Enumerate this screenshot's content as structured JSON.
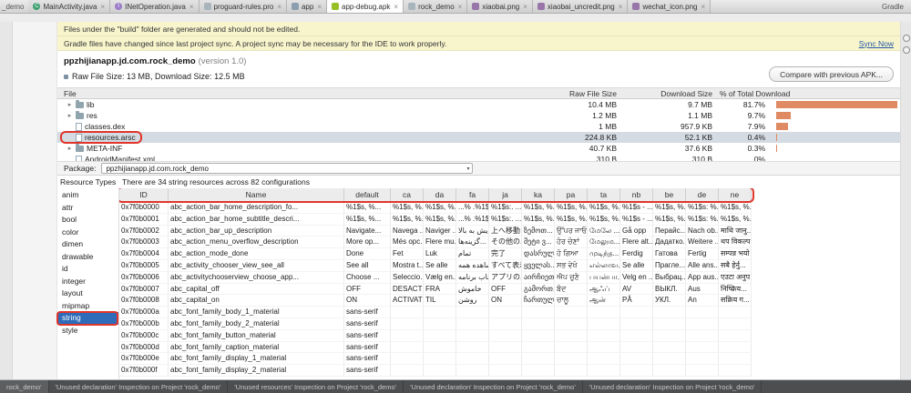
{
  "window": {
    "left_strip_label": "_demo",
    "gradle_label": "Gradle"
  },
  "icons": {
    "close": "×",
    "tree_expand": "▸",
    "dropdown_arrow": "▾"
  },
  "colors": {
    "annotation_red": "#e0352b",
    "selection_blue": "#2e6bb8",
    "bar_orange": "#e08a63",
    "banner_yellow": "#f8f5cd",
    "link_blue": "#2456a4"
  },
  "editor_tabs": {
    "tabs": [
      {
        "label": "MainActivity.java",
        "icon": "class-icon",
        "active": false
      },
      {
        "label": "INetOperation.java",
        "icon": "interface-icon",
        "active": false
      },
      {
        "label": "proguard-rules.pro",
        "icon": "text-file-icon",
        "active": false
      },
      {
        "label": "app",
        "icon": "folder-icon",
        "active": false
      },
      {
        "label": "app-debug.apk",
        "icon": "apk-icon",
        "active": true
      },
      {
        "label": "rock_demo",
        "icon": "text-file-icon",
        "active": false
      },
      {
        "label": "xiaobai.png",
        "icon": "image-icon",
        "active": false
      },
      {
        "label": "xiaobai_uncredit.png",
        "icon": "image-icon",
        "active": false
      },
      {
        "label": "wechat_icon.png",
        "icon": "image-icon",
        "active": false
      }
    ]
  },
  "banners": {
    "build": {
      "text": "Files under the \"build\" folder are generated and should not be edited."
    },
    "sync": {
      "text": "Gradle files have changed since last project sync. A project sync may be necessary for the IDE to work properly.",
      "action": "Sync Now"
    }
  },
  "apk_header": {
    "package_name": "ppzhijianapp.jd.com.rock_demo",
    "version": "(version 1.0)",
    "size_summary": "Raw File Size: 13 MB, Download Size: 12.5 MB",
    "compare_button": "Compare with previous APK..."
  },
  "file_table": {
    "columns": {
      "file": "File",
      "raw_size": "Raw File Size",
      "download_size": "Download Size",
      "percent": "% of Total Download"
    },
    "rows": [
      {
        "name": "lib",
        "kind": "folder",
        "raw_size": "10.4 MB",
        "download_size": "9.7 MB",
        "percent": "81.7%",
        "percent_value": 81.7,
        "selected": false,
        "annotated": false
      },
      {
        "name": "res",
        "kind": "folder",
        "raw_size": "1.2 MB",
        "download_size": "1.1 MB",
        "percent": "9.7%",
        "percent_value": 9.7,
        "selected": false,
        "annotated": false
      },
      {
        "name": "classes.dex",
        "kind": "file",
        "raw_size": "1 MB",
        "download_size": "957.9 KB",
        "percent": "7.9%",
        "percent_value": 7.9,
        "selected": false,
        "annotated": false
      },
      {
        "name": "resources.arsc",
        "kind": "file",
        "raw_size": "224.8 KB",
        "download_size": "52.1 KB",
        "percent": "0.4%",
        "percent_value": 0.4,
        "selected": true,
        "annotated": true
      },
      {
        "name": "META-INF",
        "kind": "folder",
        "raw_size": "40.7 KB",
        "download_size": "37.6 KB",
        "percent": "0.3%",
        "percent_value": 0.3,
        "selected": false,
        "annotated": false
      },
      {
        "name": "AndroidManifest.xml",
        "kind": "file",
        "raw_size": "310 B",
        "download_size": "310 B",
        "percent": "0%",
        "percent_value": 0,
        "selected": false,
        "annotated": false
      }
    ]
  },
  "package_selector": {
    "label": "Package:",
    "value": "ppzhijianapp.jd.com.rock_demo"
  },
  "resources": {
    "panel_title": "Resource Types",
    "summary": "There are 34 string resources across 82 configurations",
    "types": [
      "anim",
      "attr",
      "bool",
      "color",
      "dimen",
      "drawable",
      "id",
      "integer",
      "layout",
      "mipmap",
      "string",
      "style"
    ],
    "selected_type": "string"
  },
  "string_table": {
    "columns": [
      "ID",
      "Name",
      "default",
      "ca",
      "da",
      "fa",
      "ja",
      "ka",
      "pa",
      "ta",
      "nb",
      "be",
      "de",
      "ne"
    ],
    "rows": [
      [
        "0x7f0b0000",
        "abc_action_bar_home_description_fo...",
        "%1$s, %...",
        "%1$s, %...",
        "%1$s, %...",
        "...% .%1$s",
        "%1$s:. ...",
        "%1$s, %...",
        "%1$s, %...",
        "%1$s, %...",
        "%1$s - ...",
        "%1$s, %...",
        "%1$s: %...",
        "%1$s, %..."
      ],
      [
        "0x7f0b0001",
        "abc_action_bar_home_subtitle_descri...",
        "%1$s, %...",
        "%1$s, %...",
        "%1$s, %...",
        "...% .%1$s",
        "%1$s:. ...",
        "%1$s, %...",
        "%1$s, %...",
        "%1$s, %...",
        "%1$s - ...",
        "%1$s, %...",
        "%1$s: %...",
        "%1$s, %..."
      ],
      [
        "0x7f0b0002",
        "abc_action_bar_up_description",
        "Navigate...",
        "Navega ...",
        "Naviger ...",
        "پیمایش به بالا",
        "上へ移動",
        "ზემოთ...",
        "ਉੱਪਰ ਜਾਓ",
        "மேலே ...",
        "Gå opp",
        "Перайс...",
        "Nach ob...",
        "माथि जानु..."
      ],
      [
        "0x7f0b0003",
        "abc_action_menu_overflow_description",
        "More op...",
        "Més opc...",
        "Flere mu...",
        "گزینه‌ها...",
        "その他の...",
        "მეტი ვ...",
        "ਹੋਰ ਚੋਣਾਂ",
        "மேலும...",
        "Flere alt...",
        "Дадатко...",
        "Weitere ...",
        "थप विकल्प"
      ],
      [
        "0x7f0b0004",
        "abc_action_mode_done",
        "Done",
        "Fet",
        "Luk",
        "تمام",
        "完了",
        "დასრულ...",
        "ਹੋ ਗਿਆ",
        "முடிந்த...",
        "Ferdig",
        "Гатова",
        "Fertig",
        "सम्पन्न भयो"
      ],
      [
        "0x7f0b0005",
        "abc_activity_chooser_view_see_all",
        "See all",
        "Mostra t...",
        "Se alle",
        "مشاهده همه",
        "すべて表示",
        "ყველას...",
        "ਸਭ ਵੇਖੋ",
        "எல்லாவ...",
        "Se alle",
        "Прагле...",
        "Alle ans...",
        "सबै हेर्नु..."
      ],
      [
        "0x7f0b0006",
        "abc_activitychooserview_choose_app...",
        "Choose ...",
        "Seleccio...",
        "Vælg en...",
        "انتخاب برنامه",
        "アプリの...",
        "აირჩიეთ...",
        "ਐਪ ਚੁਣੋ",
        "பயன்பா...",
        "Velg en ...",
        "Выбрац...",
        "App aus...",
        "एउटा अनुप..."
      ],
      [
        "0x7f0b0007",
        "abc_capital_off",
        "OFF",
        "DESACTI...",
        "FRA",
        "خاموش",
        "OFF",
        "გამორთ...",
        "ਬੰਦ",
        "ஆஃப்",
        "AV",
        "ВЫКЛ.",
        "Aus",
        "निष्क्रिय..."
      ],
      [
        "0x7f0b0008",
        "abc_capital_on",
        "ON",
        "ACTIVAT",
        "TIL",
        "روشن",
        "ON",
        "ჩართული",
        "ਚਾਲੂ",
        "ஆன்",
        "PÅ",
        "УКЛ.",
        "An",
        "सक्रिय ग..."
      ],
      [
        "0x7f0b000a",
        "abc_font_family_body_1_material",
        "sans-serif",
        "",
        "",
        "",
        "",
        "",
        "",
        "",
        "",
        "",
        "",
        ""
      ],
      [
        "0x7f0b000b",
        "abc_font_family_body_2_material",
        "sans-serif",
        "",
        "",
        "",
        "",
        "",
        "",
        "",
        "",
        "",
        "",
        ""
      ],
      [
        "0x7f0b000c",
        "abc_font_family_button_material",
        "sans-serif",
        "",
        "",
        "",
        "",
        "",
        "",
        "",
        "",
        "",
        "",
        ""
      ],
      [
        "0x7f0b000d",
        "abc_font_family_caption_material",
        "sans-serif",
        "",
        "",
        "",
        "",
        "",
        "",
        "",
        "",
        "",
        "",
        ""
      ],
      [
        "0x7f0b000e",
        "abc_font_family_display_1_material",
        "sans-serif",
        "",
        "",
        "",
        "",
        "",
        "",
        "",
        "",
        "",
        "",
        ""
      ],
      [
        "0x7f0b000f",
        "abc_font_family_display_2_material",
        "sans-serif",
        "",
        "",
        "",
        "",
        "",
        "",
        "",
        "",
        "",
        "",
        ""
      ]
    ]
  },
  "status_bar": {
    "partial_tab": "rock_demo'",
    "tabs": [
      "'Unused declaration' Inspection on Project 'rock_demo'",
      "'Unused resources' Inspection on Project 'rock_demo'",
      "'Unused declaration' Inspection on Project 'rock_demo'",
      "'Unused declaration' Inspection on Project 'rock_demo'"
    ]
  }
}
